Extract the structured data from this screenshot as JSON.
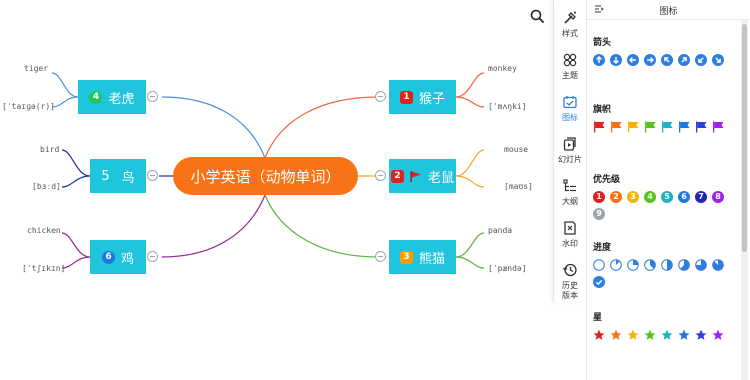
{
  "mindmap": {
    "root": "小学英语（动物单词）",
    "nodes": [
      {
        "id": "tiger",
        "num": "4",
        "label": "老虎",
        "word": "tiger",
        "phonetic": "[ˈtaɪɡə(r)]",
        "badge_color": "#22c55e"
      },
      {
        "id": "bird",
        "num": "5",
        "label": "鸟",
        "word": "bird",
        "phonetic": "[bɜːd]",
        "badge_color": ""
      },
      {
        "id": "chicken",
        "num": "6",
        "label": "鸡",
        "word": "chicken",
        "phonetic": "[ˈtʃɪkɪn]",
        "badge_color": "#1d78e0"
      },
      {
        "id": "monkey",
        "num": "1",
        "label": "猴子",
        "word": "monkey",
        "phonetic": "[ˈmʌŋki]",
        "badge_color": "#e0211c"
      },
      {
        "id": "mouse",
        "num": "2",
        "label": "老鼠",
        "word": "mouse",
        "phonetic": "[maʊs]",
        "badge_color": "#e0211c"
      },
      {
        "id": "panda",
        "num": "3",
        "label": "熊猫",
        "word": "panda",
        "phonetic": "[ˈpændə]",
        "badge_color": "#f59e0b"
      }
    ]
  },
  "toolbar": {
    "items": [
      {
        "name": "style",
        "label": "样式",
        "icon": "style-icon"
      },
      {
        "name": "theme",
        "label": "主题",
        "icon": "theme-icon"
      },
      {
        "name": "icons",
        "label": "图标",
        "icon": "icons-icon",
        "active": true
      },
      {
        "name": "slides",
        "label": "幻灯片",
        "icon": "slides-icon"
      },
      {
        "name": "outline",
        "label": "大纲",
        "icon": "outline-icon"
      },
      {
        "name": "watermark",
        "label": "水印",
        "icon": "watermark-icon"
      },
      {
        "name": "history",
        "label": "历史\n版本",
        "icon": "history-icon"
      }
    ]
  },
  "panel": {
    "title": "图标",
    "sections": {
      "arrows": {
        "title": "箭头",
        "color": "#2f7de1",
        "directions": [
          "up",
          "down",
          "left",
          "right",
          "up-left",
          "up-right",
          "down-left",
          "down-right"
        ]
      },
      "flags": {
        "title": "旗帜",
        "colors": [
          "#e0211c",
          "#f97316",
          "#f5b400",
          "#52c41a",
          "#1db2c4",
          "#1d78e0",
          "#2f3cde",
          "#a020f0"
        ]
      },
      "priority": {
        "title": "优先级",
        "items": [
          {
            "num": "1",
            "color": "#e0211c"
          },
          {
            "num": "2",
            "color": "#f97316"
          },
          {
            "num": "3",
            "color": "#f5b400"
          },
          {
            "num": "4",
            "color": "#52c41a"
          },
          {
            "num": "5",
            "color": "#1db2c4"
          },
          {
            "num": "6",
            "color": "#1d78e0"
          },
          {
            "num": "7",
            "color": "#2027b8"
          },
          {
            "num": "8",
            "color": "#a020f0"
          },
          {
            "num": "9",
            "color": "#9ca3af"
          }
        ]
      },
      "progress": {
        "title": "进度",
        "color": "#2f7de1",
        "levels": [
          0,
          0.125,
          0.25,
          0.375,
          0.5,
          0.625,
          0.75,
          0.875,
          1
        ]
      },
      "stars": {
        "title": "星",
        "colors": [
          "#e0211c",
          "#f97316",
          "#f5b400",
          "#52c41a",
          "#1db2c4",
          "#1d78e0",
          "#2f3cde",
          "#a020f0"
        ]
      }
    }
  }
}
